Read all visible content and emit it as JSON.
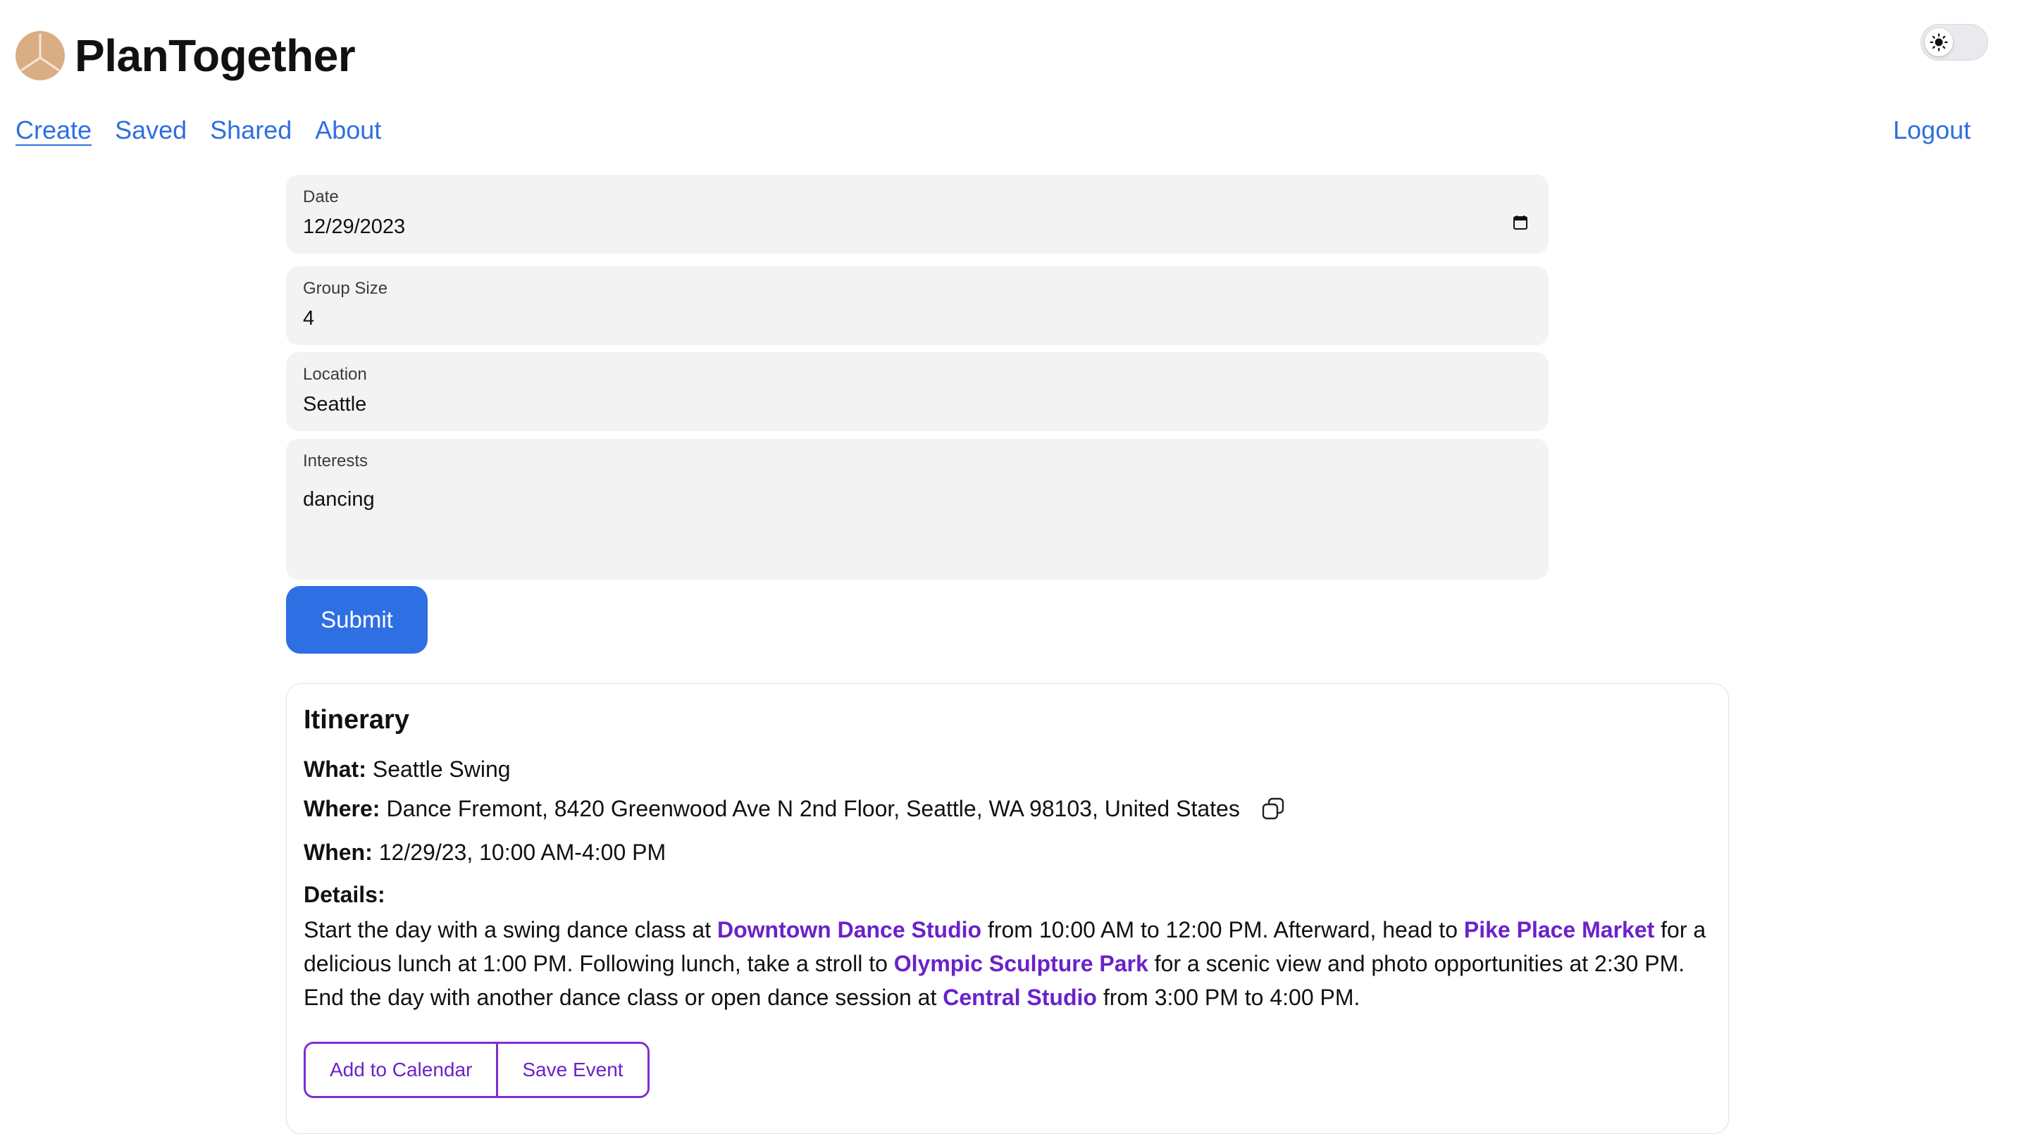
{
  "app": {
    "title": "PlanTogether"
  },
  "nav": {
    "items": [
      {
        "label": "Create",
        "active": true
      },
      {
        "label": "Saved"
      },
      {
        "label": "Shared"
      },
      {
        "label": "About"
      }
    ],
    "logout_label": "Logout"
  },
  "theme_toggle": {
    "icon": "sun-icon",
    "mode": "light"
  },
  "form": {
    "date": {
      "label": "Date",
      "value": "12/29/2023"
    },
    "group_size": {
      "label": "Group Size",
      "value": "4"
    },
    "location": {
      "label": "Location",
      "value": "Seattle"
    },
    "interests": {
      "label": "Interests",
      "value": "dancing"
    },
    "submit_label": "Submit"
  },
  "itinerary": {
    "title": "Itinerary",
    "what_label": "What:",
    "what": "Seattle Swing",
    "where_label": "Where:",
    "where": "Dance Fremont, 8420 Greenwood Ave N 2nd Floor, Seattle, WA 98103, United States",
    "when_label": "When:",
    "when": "12/29/23, 10:00 AM-4:00 PM",
    "details_label": "Details:",
    "details": [
      {
        "text": "Start the day with a swing dance class at "
      },
      {
        "text": "Downtown Dance Studio",
        "place": true
      },
      {
        "text": " from 10:00 AM to 12:00 PM. Afterward, head to "
      },
      {
        "text": "Pike Place Market",
        "place": true
      },
      {
        "text": " for a delicious lunch at 1:00 PM. Following lunch, take a stroll to "
      },
      {
        "text": "Olympic Sculpture Park",
        "place": true
      },
      {
        "text": " for a scenic view and photo opportunities at 2:30 PM. End the day with another dance class or open dance session at "
      },
      {
        "text": "Central Studio",
        "place": true
      },
      {
        "text": " from 3:00 PM to 4:00 PM."
      }
    ],
    "actions": {
      "add_to_calendar": "Add to Calendar",
      "save_event": "Save Event"
    }
  },
  "colors": {
    "link": "#2f6fde",
    "primary": "#2f6fe4",
    "accent": "#6b22c9",
    "logo": "#d9ae85",
    "field_bg": "#f3f3f3"
  }
}
